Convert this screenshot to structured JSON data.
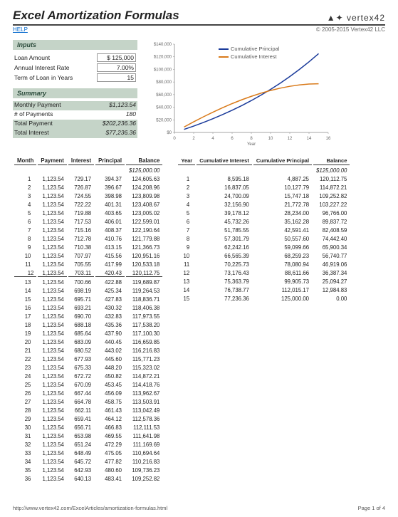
{
  "header": {
    "title": "Excel Amortization Formulas",
    "logo": "▲✦ vertex42",
    "help": "HELP",
    "copyright": "© 2005-2015 Vertex42 LLC"
  },
  "inputs": {
    "heading": "Inputs",
    "loan_amount_label": "Loan Amount",
    "loan_amount_value": "$   125,000",
    "rate_label": "Annual Interest Rate",
    "rate_value": "7.00%",
    "term_label": "Term of Loan in Years",
    "term_value": "15"
  },
  "summary": {
    "heading": "Summary",
    "monthly_label": "Monthly Payment",
    "monthly_value": "$1,123.54",
    "count_label": "# of Payments",
    "count_value": "180",
    "total_pay_label": "Total Payment",
    "total_pay_value": "$202,236.36",
    "total_int_label": "Total Interest",
    "total_int_value": "$77,236.36"
  },
  "monthly_cols": [
    "Month",
    "Payment",
    "Interest",
    "Principal",
    "Balance"
  ],
  "monthly_start": "$125,000.00",
  "monthly": [
    [
      "1",
      "1,123.54",
      "729.17",
      "394.37",
      "124,605.63"
    ],
    [
      "2",
      "1,123.54",
      "726.87",
      "396.67",
      "124,208.96"
    ],
    [
      "3",
      "1,123.54",
      "724.55",
      "398.98",
      "123,809.98"
    ],
    [
      "4",
      "1,123.54",
      "722.22",
      "401.31",
      "123,408.67"
    ],
    [
      "5",
      "1,123.54",
      "719.88",
      "403.65",
      "123,005.02"
    ],
    [
      "6",
      "1,123.54",
      "717.53",
      "406.01",
      "122,599.01"
    ],
    [
      "7",
      "1,123.54",
      "715.16",
      "408.37",
      "122,190.64"
    ],
    [
      "8",
      "1,123.54",
      "712.78",
      "410.76",
      "121,779.88"
    ],
    [
      "9",
      "1,123.54",
      "710.38",
      "413.15",
      "121,366.73"
    ],
    [
      "10",
      "1,123.54",
      "707.97",
      "415.56",
      "120,951.16"
    ],
    [
      "11",
      "1,123.54",
      "705.55",
      "417.99",
      "120,533.18"
    ],
    [
      "12",
      "1,123.54",
      "703.11",
      "420.43",
      "120,112.75"
    ],
    [
      "13",
      "1,123.54",
      "700.66",
      "422.88",
      "119,689.87"
    ],
    [
      "14",
      "1,123.54",
      "698.19",
      "425.34",
      "119,264.53"
    ],
    [
      "15",
      "1,123.54",
      "695.71",
      "427.83",
      "118,836.71"
    ],
    [
      "16",
      "1,123.54",
      "693.21",
      "430.32",
      "118,406.38"
    ],
    [
      "17",
      "1,123.54",
      "690.70",
      "432.83",
      "117,973.55"
    ],
    [
      "18",
      "1,123.54",
      "688.18",
      "435.36",
      "117,538.20"
    ],
    [
      "19",
      "1,123.54",
      "685.64",
      "437.90",
      "117,100.30"
    ],
    [
      "20",
      "1,123.54",
      "683.09",
      "440.45",
      "116,659.85"
    ],
    [
      "21",
      "1,123.54",
      "680.52",
      "443.02",
      "116,216.83"
    ],
    [
      "22",
      "1,123.54",
      "677.93",
      "445.60",
      "115,771.23"
    ],
    [
      "23",
      "1,123.54",
      "675.33",
      "448.20",
      "115,323.02"
    ],
    [
      "24",
      "1,123.54",
      "672.72",
      "450.82",
      "114,872.21"
    ],
    [
      "25",
      "1,123.54",
      "670.09",
      "453.45",
      "114,418.76"
    ],
    [
      "26",
      "1,123.54",
      "667.44",
      "456.09",
      "113,962.67"
    ],
    [
      "27",
      "1,123.54",
      "664.78",
      "458.75",
      "113,503.91"
    ],
    [
      "28",
      "1,123.54",
      "662.11",
      "461.43",
      "113,042.49"
    ],
    [
      "29",
      "1,123.54",
      "659.41",
      "464.12",
      "112,578.36"
    ],
    [
      "30",
      "1,123.54",
      "656.71",
      "466.83",
      "112,111.53"
    ],
    [
      "31",
      "1,123.54",
      "653.98",
      "469.55",
      "111,641.98"
    ],
    [
      "32",
      "1,123.54",
      "651.24",
      "472.29",
      "111,169.69"
    ],
    [
      "33",
      "1,123.54",
      "648.49",
      "475.05",
      "110,694.64"
    ],
    [
      "34",
      "1,123.54",
      "645.72",
      "477.82",
      "110,216.83"
    ],
    [
      "35",
      "1,123.54",
      "642.93",
      "480.60",
      "109,736.23"
    ],
    [
      "36",
      "1,123.54",
      "640.13",
      "483.41",
      "109,252.82"
    ]
  ],
  "yearly_cols": [
    "Year",
    "Cumulative Interest",
    "Cumulative Principal",
    "Balance"
  ],
  "yearly_start": "$125,000.00",
  "yearly": [
    [
      "1",
      "8,595.18",
      "4,887.25",
      "120,112.75"
    ],
    [
      "2",
      "16,837.05",
      "10,127.79",
      "114,872.21"
    ],
    [
      "3",
      "24,700.09",
      "15,747.18",
      "109,252.82"
    ],
    [
      "4",
      "32,156.90",
      "21,772.78",
      "103,227.22"
    ],
    [
      "5",
      "39,178.12",
      "28,234.00",
      "96,766.00"
    ],
    [
      "6",
      "45,732.26",
      "35,162.28",
      "89,837.72"
    ],
    [
      "7",
      "51,785.55",
      "42,591.41",
      "82,408.59"
    ],
    [
      "8",
      "57,301.79",
      "50,557.60",
      "74,442.40"
    ],
    [
      "9",
      "62,242.16",
      "59,099.66",
      "65,900.34"
    ],
    [
      "10",
      "66,565.39",
      "68,259.23",
      "56,740.77"
    ],
    [
      "11",
      "70,225.73",
      "78,080.94",
      "46,919.06"
    ],
    [
      "12",
      "73,176.43",
      "88,611.66",
      "36,387.34"
    ],
    [
      "13",
      "75,363.79",
      "99,905.73",
      "25,094.27"
    ],
    [
      "14",
      "76,738.77",
      "112,015.17",
      "12,984.83"
    ],
    [
      "15",
      "77,236.36",
      "125,000.00",
      "0.00"
    ]
  ],
  "chart_data": {
    "type": "line",
    "title": "",
    "xlabel": "Year",
    "ylabel": "",
    "xlim": [
      0,
      16
    ],
    "ylim": [
      0,
      140000
    ],
    "yticks": [
      "$0",
      "$20,000",
      "$40,000",
      "$60,000",
      "$80,000",
      "$100,000",
      "$120,000",
      "$140,000"
    ],
    "xticks": [
      "0",
      "2",
      "4",
      "6",
      "8",
      "10",
      "12",
      "14",
      "16"
    ],
    "series": [
      {
        "name": "Cumulative Principal",
        "color": "#1a3a9a",
        "x": [
          1,
          2,
          3,
          4,
          5,
          6,
          7,
          8,
          9,
          10,
          11,
          12,
          13,
          14,
          15
        ],
        "y": [
          4887,
          10128,
          15747,
          21773,
          28234,
          35162,
          42591,
          50558,
          59100,
          68259,
          78081,
          88612,
          99906,
          112015,
          125000
        ]
      },
      {
        "name": "Cumulative Interest",
        "color": "#d97a1a",
        "x": [
          1,
          2,
          3,
          4,
          5,
          6,
          7,
          8,
          9,
          10,
          11,
          12,
          13,
          14,
          15
        ],
        "y": [
          8595,
          16837,
          24700,
          32157,
          39178,
          45732,
          51786,
          57302,
          62242,
          66565,
          70226,
          73176,
          75364,
          76739,
          77236
        ]
      }
    ]
  },
  "footer": {
    "url": "http://www.vertex42.com/ExcelArticles/amortization-formulas.html",
    "page": "Page 1 of 4"
  }
}
